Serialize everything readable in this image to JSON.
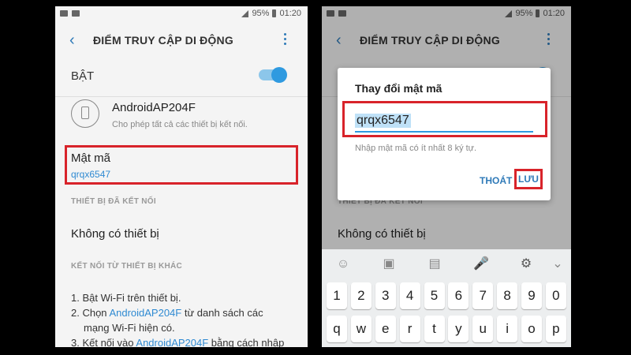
{
  "status": {
    "battery": "95%",
    "time": "01:20"
  },
  "header": {
    "title": "ĐIỂM TRUY CẬP DI ĐỘNG"
  },
  "settings": {
    "on_label": "BẬT",
    "ap_name": "AndroidAP204F",
    "ap_desc": "Cho phép tất cả các thiết bị kết nối.",
    "password_label": "Mật mã",
    "password_value": "qrqx6547",
    "connected_section": "THIẾT BỊ ĐÃ KẾT NỐI",
    "no_devices": "Không có thiết bị",
    "other_section": "KẾT NỐI TỪ THIẾT BỊ KHÁC",
    "steps": [
      {
        "text": "1. Bật Wi-Fi trên thiết bị."
      },
      {
        "pre": "2. Chọn ",
        "link": "AndroidAP204F",
        "post": " từ danh sách các"
      },
      {
        "text": "mạng Wi-Fi hiện có."
      },
      {
        "pre": "3. Kết nối vào ",
        "link": "AndroidAP204F",
        "post": " bằng cách nhập"
      }
    ]
  },
  "dialog": {
    "title": "Thay đổi mật mã",
    "input_value": "qrqx6547",
    "hint": "Nhập mật mã có ít nhất 8 ký tự.",
    "cancel": "THOÁT",
    "save": "LƯU"
  },
  "keyboard": {
    "toolbar_icons": [
      "emoji-icon",
      "sticker-icon",
      "gif-icon",
      "mic-icon",
      "gear-icon",
      "chevron-down-icon"
    ],
    "row1": [
      "1",
      "2",
      "3",
      "4",
      "5",
      "6",
      "7",
      "8",
      "9",
      "0"
    ],
    "row2": [
      "q",
      "w",
      "e",
      "r",
      "t",
      "y",
      "u",
      "i",
      "o",
      "p"
    ]
  },
  "colors": {
    "accent": "#2f9ae0",
    "highlight": "#d8232a"
  }
}
